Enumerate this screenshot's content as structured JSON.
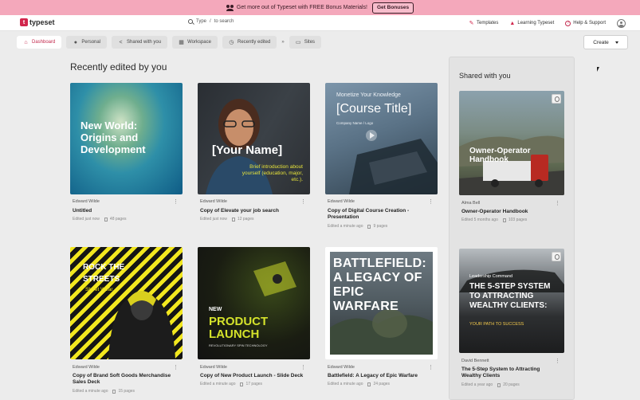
{
  "banner": {
    "text": "Get more out of Typeset with FREE Bonus Materials!",
    "button": "Get Bonuses"
  },
  "brand": {
    "logo_letter": "t",
    "name": "typeset",
    "accent": "#d1264c"
  },
  "search": {
    "text_left": "Type",
    "separator": "/",
    "text_right": "to search",
    "icon": "search-icon"
  },
  "nav": {
    "templates": {
      "label": "Templates",
      "icon": "templates-icon"
    },
    "learning": {
      "label": "Learning Typeset",
      "icon": "graduation-cap-icon"
    },
    "help": {
      "label": "Help & Support",
      "icon": "help-icon"
    }
  },
  "tabs": [
    {
      "label": "Dashboard",
      "icon": "home-icon",
      "active": true
    },
    {
      "label": "Personal",
      "icon": "user-icon"
    },
    {
      "label": "Shared with you",
      "icon": "share-icon"
    },
    {
      "label": "Workspace",
      "icon": "workspace-icon"
    },
    {
      "label": "Recently edited",
      "icon": "clock-icon"
    },
    {
      "label": "Sites",
      "icon": "sites-icon"
    }
  ],
  "tab_separator": "»",
  "create_button": "Create",
  "recent": {
    "title": "Recently edited by you",
    "cards": [
      {
        "author": "Edward Wilde",
        "title": "Untitled",
        "edited": "Edited just now",
        "pages": "48 pages",
        "thumb_text": "New World: Origins and Development"
      },
      {
        "author": "Edward Wilde",
        "title": "Copy of Elevate your job search",
        "edited": "Edited just now",
        "pages": "12 pages",
        "thumb_text": "[Your Name]",
        "thumb_sub": "Brief introduction about yourself (education, major, etc.)."
      },
      {
        "author": "Edward Wilde",
        "title": "Copy of Digital Course Creation - Presentation",
        "edited": "Edited a minute ago",
        "pages": "9 pages",
        "thumb_kicker": "Monetize Your Knowledge",
        "thumb_text": "[Course Title]",
        "thumb_sub": "Company Name / Logo"
      },
      {
        "author": "Edward Wilde",
        "title": "Copy of Brand Soft Goods Merchandise Sales Deck",
        "edited": "Edited a minute ago",
        "pages": "15 pages",
        "thumb_text": "ROCK THE STREETS",
        "thumb_sub": "Street Wear"
      },
      {
        "author": "Edward Wilde",
        "title": "Copy of New Product Launch - Slide Deck",
        "edited": "Edited a minute ago",
        "pages": "17 pages",
        "thumb_kicker": "NEW",
        "thumb_text": "PRODUCT LAUNCH",
        "thumb_sub": "REVOLUTIONARY SPIN TECHNOLOGY"
      },
      {
        "author": "Edward Wilde",
        "title": "Battlefield: A Legacy of Epic Warfare",
        "edited": "Edited a minute ago",
        "pages": "24 pages",
        "thumb_text": "BATTLEFIELD: A LEGACY OF EPIC WARFARE"
      }
    ]
  },
  "shared": {
    "title": "Shared with you",
    "cards": [
      {
        "author": "Alma Bell",
        "title": "Owner-Operator Handbook",
        "edited": "Edited 5 months ago",
        "pages": "103 pages",
        "thumb_text": "Owner-Operator Handbook"
      },
      {
        "author": "David Bennett",
        "title": "The 5-Step System to Attracting Wealthy Clients",
        "edited": "Edited a year ago",
        "pages": "20 pages",
        "thumb_kicker": "Leadership Command",
        "thumb_text": "THE 5-STEP SYSTEM TO ATTRACTING WEALTHY CLIENTS:",
        "thumb_sub": "YOUR PATH TO SUCCESS"
      }
    ]
  },
  "more_icon": "kebab-menu-icon",
  "pages_icon": "page-icon"
}
